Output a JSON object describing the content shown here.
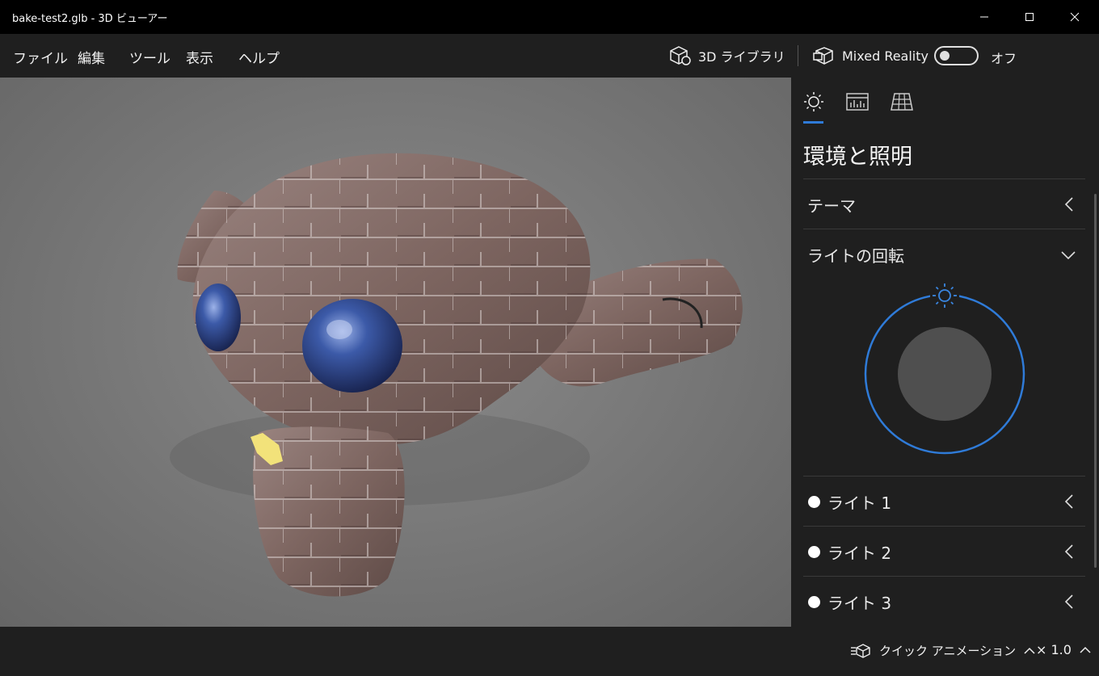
{
  "window": {
    "title": "bake-test2.glb - 3D ビューアー"
  },
  "menu": {
    "items": [
      "ファイル",
      "編集",
      "ツール",
      "表示",
      "ヘルプ"
    ],
    "library_label": "3D ライブラリ",
    "mixed_reality_label": "Mixed Reality",
    "toggle_state_label": "オフ"
  },
  "panel": {
    "title": "環境と照明",
    "sections": {
      "theme": "テーマ",
      "light_rotation": "ライトの回転",
      "light1": "ライト 1",
      "light2": "ライト 2",
      "light3": "ライト 3"
    },
    "tabs": [
      "sun-settings-icon",
      "stats-chart-icon",
      "grid-icon"
    ]
  },
  "bottom": {
    "quick_animation_label": "クイック アニメーション",
    "speed_label": "× 1.0"
  },
  "colors": {
    "accent": "#2f7bd8",
    "background": "#1f1f1f",
    "titlebar": "#000000"
  }
}
